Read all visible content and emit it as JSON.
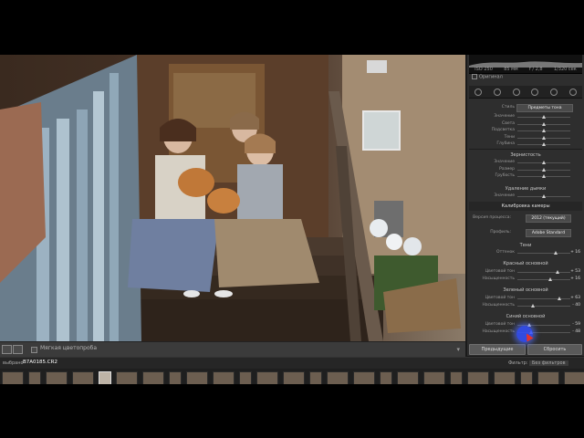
{
  "histogram": {
    "iso": "ISO 250",
    "focal": "85 мм",
    "aperture": "f / 2,8",
    "shutter": "1/320 сек"
  },
  "original_photo_label": "Оригинал",
  "tone_curve": {
    "region_label": "Стиль",
    "region_value": "Предметы тона",
    "rows": [
      {
        "label": "Значение",
        "value": "",
        "knob": 0.5
      },
      {
        "label": "Света",
        "value": "",
        "knob": 0.5
      },
      {
        "label": "Подсветка",
        "value": "",
        "knob": 0.5
      },
      {
        "label": "Тени",
        "value": "",
        "knob": 0.5
      },
      {
        "label": "Глубина",
        "value": "",
        "knob": 0.5
      }
    ]
  },
  "split": {
    "title": "Зернистость",
    "rows": [
      {
        "label": "Значение",
        "value": "",
        "knob": 0.5
      },
      {
        "label": "Размер",
        "value": "",
        "knob": 0.5
      },
      {
        "label": "Грубость",
        "value": "",
        "knob": 0.5
      }
    ]
  },
  "dehaze": {
    "title": "Удаление дымки",
    "rows": [
      {
        "label": "Значение",
        "value": "",
        "knob": 0.5
      }
    ]
  },
  "calibration": {
    "header": "Калибровка камеры",
    "process_label": "Версия процесса:",
    "process_value": "2012 (текущий)",
    "profile_label": "Профиль:",
    "profile_value": "Adobe Standard",
    "shadows_title": "Тени",
    "shadows_tint": {
      "label": "Оттенок",
      "value": "+ 16",
      "knob": 0.72
    },
    "red_title": "Красный основной",
    "red_rows": [
      {
        "label": "Цветовой тон",
        "value": "+ 53",
        "knob": 0.76
      },
      {
        "label": "Насыщенность",
        "value": "+ 16",
        "knob": 0.62
      }
    ],
    "green_title": "Зеленый основной",
    "green_rows": [
      {
        "label": "Цветовой тон",
        "value": "+ 63",
        "knob": 0.8
      },
      {
        "label": "Насыщенность",
        "value": "- 40",
        "knob": 0.3
      }
    ],
    "blue_title": "Синий основной",
    "blue_rows": [
      {
        "label": "Цветовой тон",
        "value": "- 59",
        "knob": 0.22
      },
      {
        "label": "Насыщенность",
        "value": "- 48",
        "knob": 0.26
      }
    ]
  },
  "buttons": {
    "previous": "Предыдущие",
    "reset": "Сбросить"
  },
  "toolbar": {
    "label": "Мягкая цветопроба"
  },
  "filmstrip": {
    "prefix": "выбрано",
    "file": "B7A0185.CR2",
    "filter_label": "Фильтр:",
    "filter_value": "Без фильтров"
  }
}
